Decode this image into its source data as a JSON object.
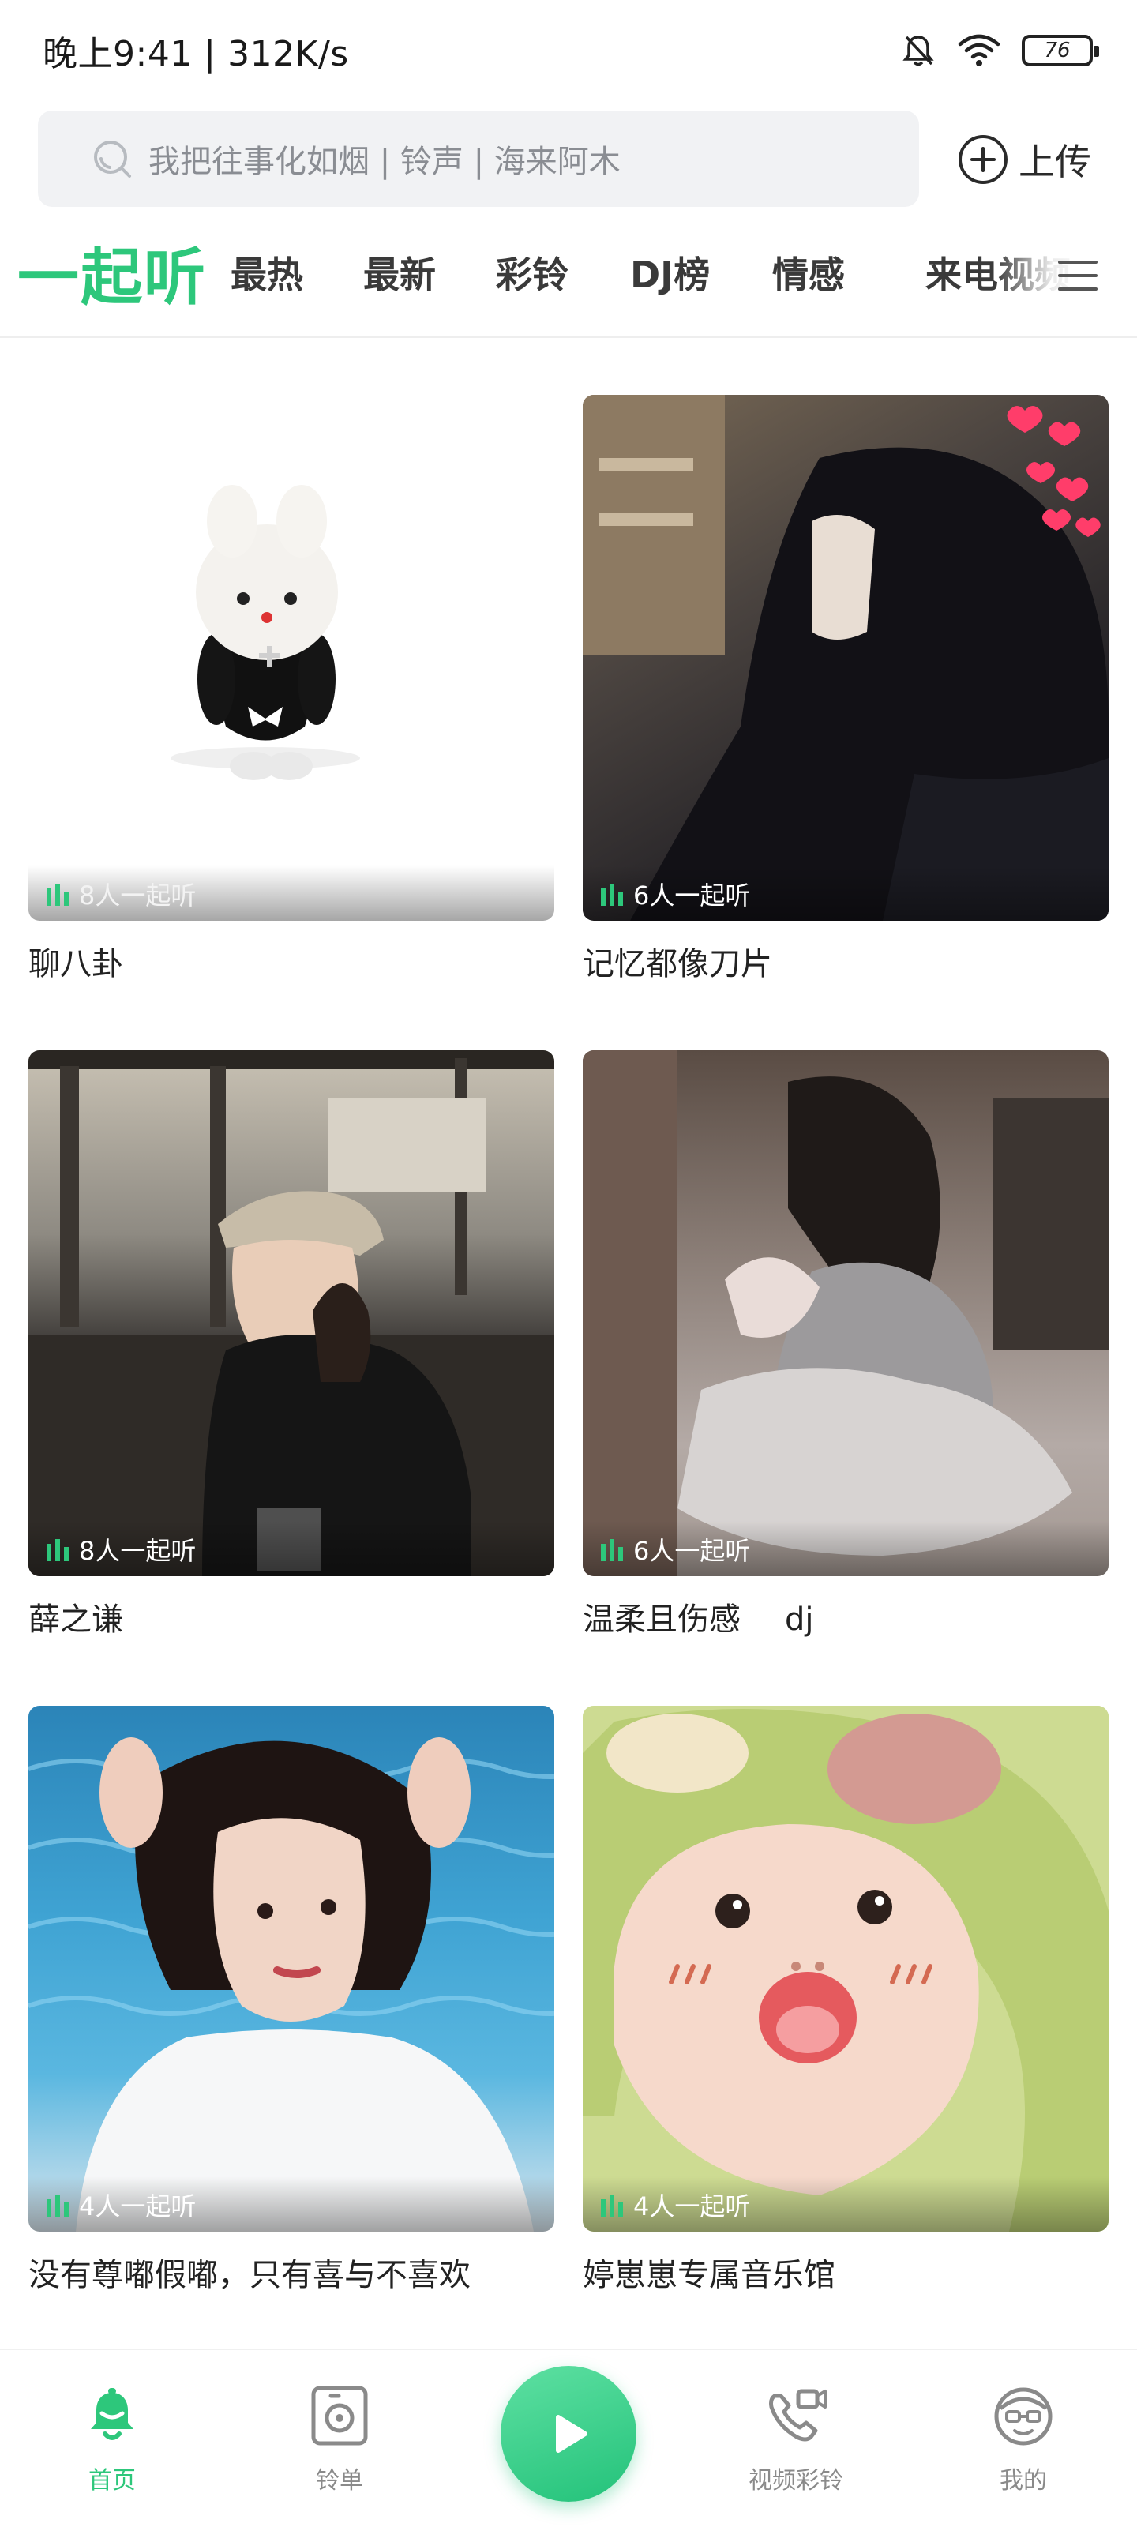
{
  "status_bar": {
    "time": "晚上9:41 | 312K/s",
    "battery": "76",
    "icons": [
      "mute-bell-icon",
      "wifi-icon",
      "battery-icon"
    ]
  },
  "search": {
    "placeholder": "我把往事化如烟 | 铃声 | 海来阿木",
    "upload_label": "上传"
  },
  "tabs": [
    {
      "label": "一起听",
      "active": true
    },
    {
      "label": "最热"
    },
    {
      "label": "最新"
    },
    {
      "label": "彩铃"
    },
    {
      "label": "DJ榜"
    },
    {
      "label": "情感"
    },
    {
      "label": "来电视频"
    }
  ],
  "rooms": [
    {
      "listeners": "8人一起听",
      "title": "聊八卦"
    },
    {
      "listeners": "6人一起听",
      "title": "记忆都像刀片"
    },
    {
      "listeners": "8人一起听",
      "title": "薛之谦"
    },
    {
      "listeners": "6人一起听",
      "title": "温柔且伤感",
      "suffix": "dj"
    },
    {
      "listeners": "4人一起听",
      "title": "没有尊嘟假嘟，只有喜与不喜欢"
    },
    {
      "listeners": "4人一起听",
      "title": "婷崽崽专属音乐馆"
    }
  ],
  "bottom_nav": [
    {
      "label": "首页",
      "icon": "bell-icon",
      "active": true
    },
    {
      "label": "铃单",
      "icon": "speaker-icon"
    },
    {
      "label": "",
      "icon": "play-icon"
    },
    {
      "label": "视频彩铃",
      "icon": "video-call-icon"
    },
    {
      "label": "我的",
      "icon": "profile-face-icon"
    }
  ],
  "colors": {
    "accent": "#2dc77b",
    "text": "#222222",
    "muted": "#8a8a8a",
    "search_bg": "#f1f2f4"
  }
}
